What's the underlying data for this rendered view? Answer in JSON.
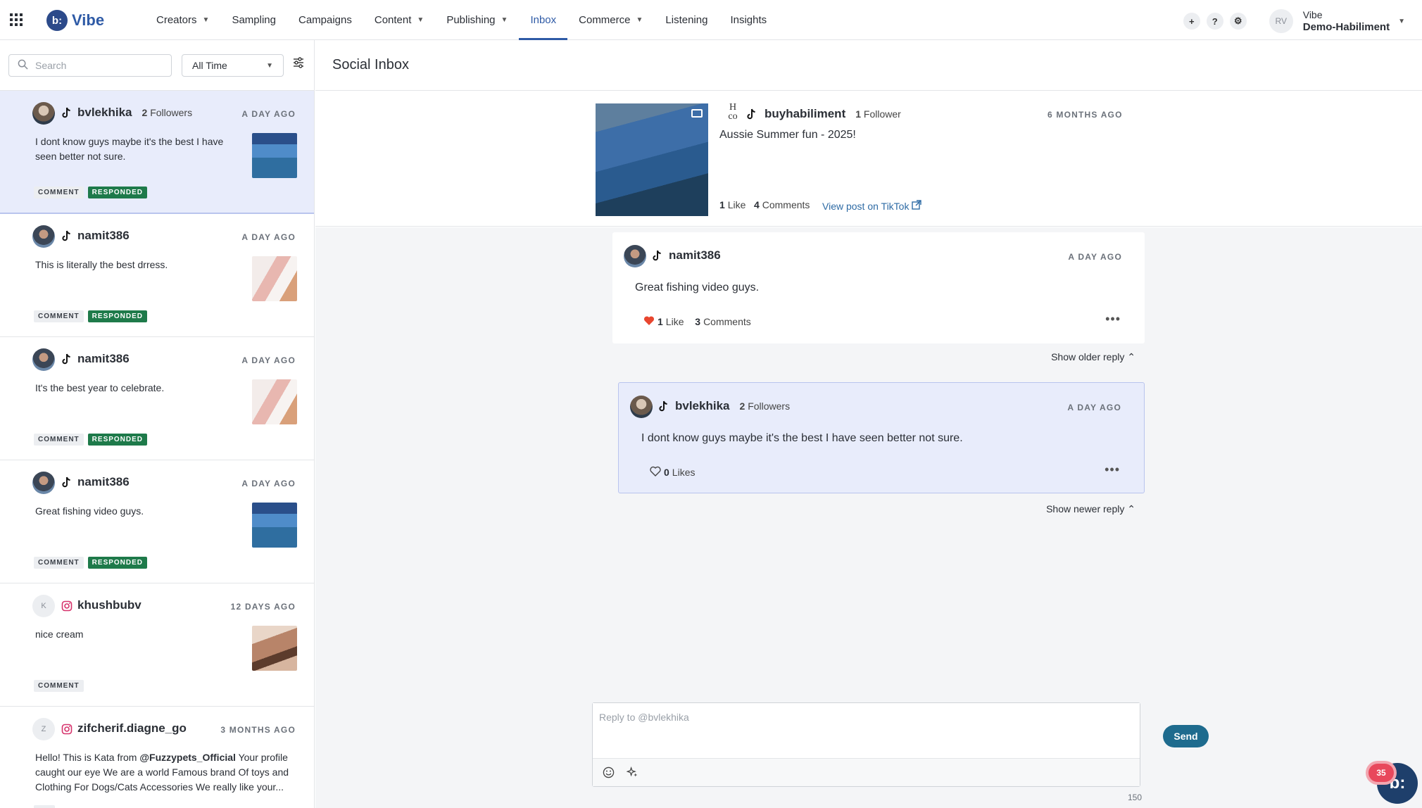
{
  "app": {
    "brand": "Vibe",
    "logo_mark": "b:"
  },
  "nav": {
    "items": [
      {
        "label": "Creators",
        "dropdown": true
      },
      {
        "label": "Sampling",
        "dropdown": false
      },
      {
        "label": "Campaigns",
        "dropdown": false
      },
      {
        "label": "Content",
        "dropdown": true
      },
      {
        "label": "Publishing",
        "dropdown": true
      },
      {
        "label": "Inbox",
        "dropdown": false,
        "active": true
      },
      {
        "label": "Commerce",
        "dropdown": true
      },
      {
        "label": "Listening",
        "dropdown": false
      },
      {
        "label": "Insights",
        "dropdown": false
      }
    ],
    "plus_icon": "+",
    "help_icon": "?",
    "settings_icon": "⚙",
    "avatar_initials": "RV",
    "account_org": "Vibe",
    "account_name": "Demo-Habiliment"
  },
  "filters": {
    "search_placeholder": "Search",
    "time_range": "All Time"
  },
  "conversations": [
    {
      "user": "bvlekhika",
      "platform": "tiktok",
      "followers_count": "2",
      "followers_label": "Followers",
      "time": "A DAY AGO",
      "message": "I dont know guys maybe it's the best I have seen better not sure.",
      "tags": [
        "COMMENT",
        "RESPONDED"
      ],
      "selected": true
    },
    {
      "user": "namit386",
      "platform": "tiktok",
      "time": "A DAY AGO",
      "message": "This is literally the best drress.",
      "tags": [
        "COMMENT",
        "RESPONDED"
      ]
    },
    {
      "user": "namit386",
      "platform": "tiktok",
      "time": "A DAY AGO",
      "message": "It's the best year to celebrate.",
      "tags": [
        "COMMENT",
        "RESPONDED"
      ]
    },
    {
      "user": "namit386",
      "platform": "tiktok",
      "time": "A DAY AGO",
      "message": "Great fishing video guys.",
      "tags": [
        "COMMENT",
        "RESPONDED"
      ]
    },
    {
      "user": "khushbubv",
      "platform": "instagram",
      "avatar_letter": "K",
      "time": "12 DAYS AGO",
      "message": "nice cream",
      "tags": [
        "COMMENT"
      ]
    },
    {
      "user": "zifcherif.diagne_go",
      "platform": "instagram",
      "avatar_letter": "Z",
      "time": "3 MONTHS AGO",
      "message_prefix": "Hello! This is Kata from ",
      "message_mention": "@Fuzzypets_Official",
      "message_suffix": " Your profile caught our eye We are a world Famous brand Of toys and Clothing For Dogs/Cats Accessories We really like your...",
      "tags": [
        "DM"
      ]
    }
  ],
  "main": {
    "title": "Social Inbox",
    "post": {
      "avatar_text": "H co",
      "user": "buyhabiliment",
      "followers_count": "1",
      "followers_label": "Follower",
      "time": "6 MONTHS AGO",
      "caption": "Aussie Summer fun - 2025!",
      "likes_count": "1",
      "likes_label": "Like",
      "comments_count": "4",
      "comments_label": "Comments",
      "view_link": "View post on TikTok"
    },
    "root_comment": {
      "user": "namit386",
      "time": "A DAY AGO",
      "text": "Great fishing video guys.",
      "likes_count": "1",
      "likes_label": "Like",
      "comments_count": "3",
      "comments_label": "Comments"
    },
    "show_older": "Show older reply",
    "reply": {
      "user": "bvlekhika",
      "followers_count": "2",
      "followers_label": "Followers",
      "time": "A DAY AGO",
      "text": "I dont know guys maybe it's the best I have seen better not sure.",
      "likes_count": "0",
      "likes_label": "Likes"
    },
    "show_newer": "Show newer reply",
    "composer": {
      "placeholder": "Reply to @bvlekhika",
      "char_count": "150",
      "send_label": "Send"
    }
  },
  "fab": {
    "badge": "35",
    "mark": "b:"
  },
  "colors": {
    "brand": "#2e5aa6",
    "responded": "#1e7a4a",
    "send": "#1e6b8e",
    "selected_bg": "#e8ecfb"
  }
}
